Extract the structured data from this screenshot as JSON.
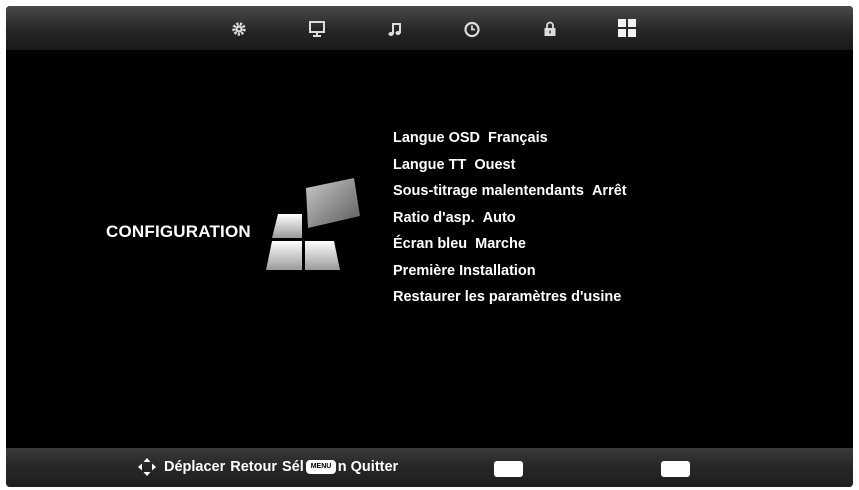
{
  "top_tabs": [
    {
      "icon": "gear-icon",
      "name": "Réglages"
    },
    {
      "icon": "monitor-icon",
      "name": "Image"
    },
    {
      "icon": "music-note-icon",
      "name": "Son"
    },
    {
      "icon": "clock-icon",
      "name": "Heure"
    },
    {
      "icon": "lock-icon",
      "name": "Verrouillage"
    },
    {
      "icon": "grid-icon",
      "name": "Configuration"
    }
  ],
  "section": {
    "title": "CONFIGURATION"
  },
  "menu": {
    "items": [
      {
        "label": "Langue OSD",
        "value": "Français"
      },
      {
        "label": "Langue TT",
        "value": "Ouest"
      },
      {
        "label": "Sous-titrage malentendants",
        "value": "Arrêt"
      },
      {
        "label": "Ratio d'asp.",
        "value": "Auto"
      },
      {
        "label": "Écran bleu",
        "value": "Marche"
      },
      {
        "label": "Première Installation",
        "value": ""
      },
      {
        "label": "Restaurer les paramètres d'usine",
        "value": ""
      }
    ]
  },
  "footer": {
    "move": "Déplacer",
    "back": "Retour",
    "select": "Sél",
    "menu_key": "MENU",
    "quit": "n Quitter"
  },
  "colors": {
    "background": "#000000",
    "text": "#ffffff",
    "bar": "#2e2e2e"
  }
}
